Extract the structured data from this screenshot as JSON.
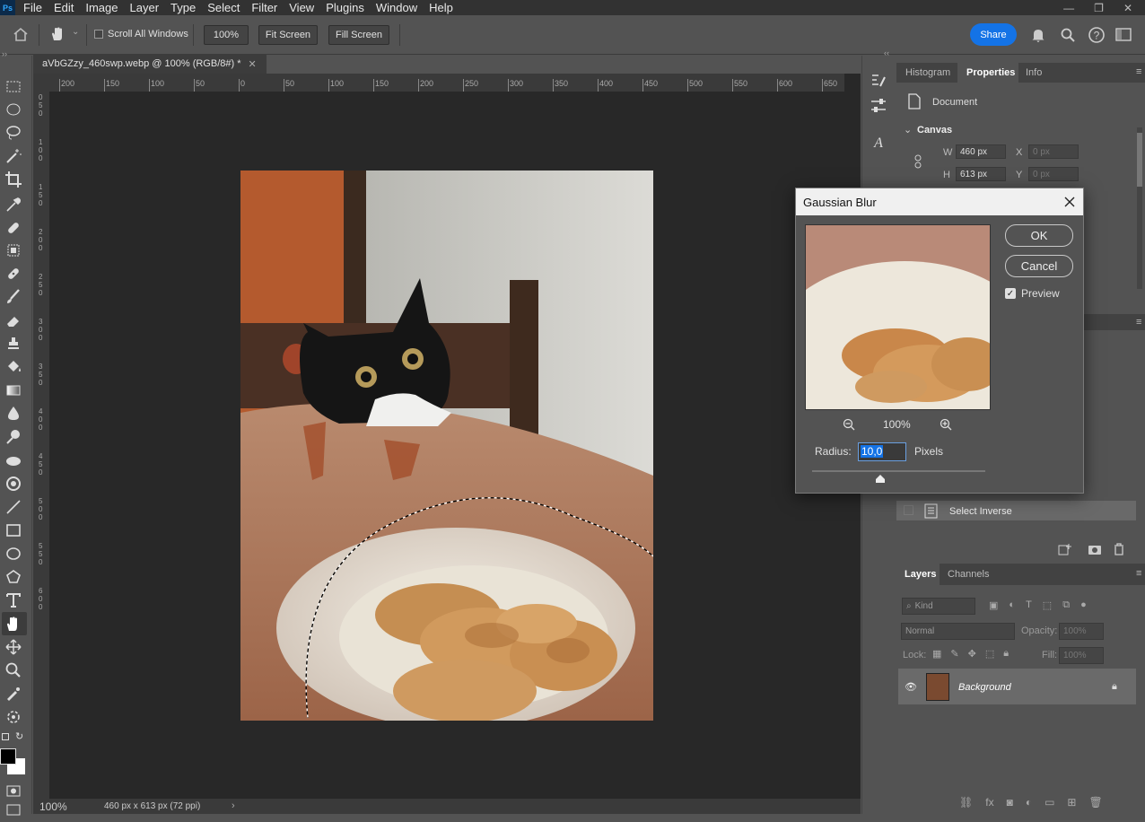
{
  "menu": [
    "File",
    "Edit",
    "Image",
    "Layer",
    "Type",
    "Select",
    "Filter",
    "View",
    "Plugins",
    "Window",
    "Help"
  ],
  "app_logo": "Ps",
  "options": {
    "scroll_all_windows": "Scroll All Windows",
    "zoom_field": "100%",
    "fit_screen": "Fit Screen",
    "fill_screen": "Fill Screen",
    "share": "Share"
  },
  "document": {
    "tab_title": "aVbGZzy_460swp.webp @ 100% (RGB/8#) *",
    "zoom": "100%",
    "info": "460 px x 613 px (72 ppi)"
  },
  "ruler_h": [
    "200",
    "150",
    "100",
    "50",
    "0",
    "50",
    "100",
    "150",
    "200",
    "250",
    "300",
    "350",
    "400",
    "450",
    "500",
    "550",
    "600",
    "650"
  ],
  "ruler_v": [
    "0",
    "5",
    "0",
    "1",
    "0",
    "0",
    "1",
    "5",
    "0",
    "2",
    "0",
    "0",
    "2",
    "5",
    "0",
    "3",
    "0",
    "0",
    "3",
    "5",
    "0",
    "4",
    "0",
    "0",
    "4",
    "5",
    "0",
    "5",
    "0",
    "0",
    "5",
    "5",
    "0",
    "6",
    "0",
    "0"
  ],
  "panels": {
    "tabs": [
      "Histogram",
      "Properties",
      "Info"
    ],
    "active_tab": "Properties",
    "document_label": "Document",
    "canvas_label": "Canvas",
    "w_label": "W",
    "w_value": "460 px",
    "h_label": "H",
    "h_value": "613 px",
    "x_label": "X",
    "x_value": "0 px",
    "y_label": "Y",
    "y_value": "0 px",
    "history_last": "Select Inverse",
    "layers_tabs": [
      "Layers",
      "Channels"
    ],
    "kind": "Kind",
    "blend_mode": "Normal",
    "opacity_label": "Opacity:",
    "opacity_value": "100%",
    "lock_label": "Lock:",
    "fill_label": "Fill:",
    "fill_value": "100%",
    "layer_name": "Background"
  },
  "dialog": {
    "title": "Gaussian Blur",
    "ok": "OK",
    "cancel": "Cancel",
    "preview_label": "Preview",
    "preview_checked": true,
    "zoom": "100%",
    "radius_label": "Radius:",
    "radius_value": "10,0",
    "units": "Pixels"
  },
  "colors": {
    "accent": "#1473e6",
    "panel": "#535353",
    "dark": "#282828"
  }
}
